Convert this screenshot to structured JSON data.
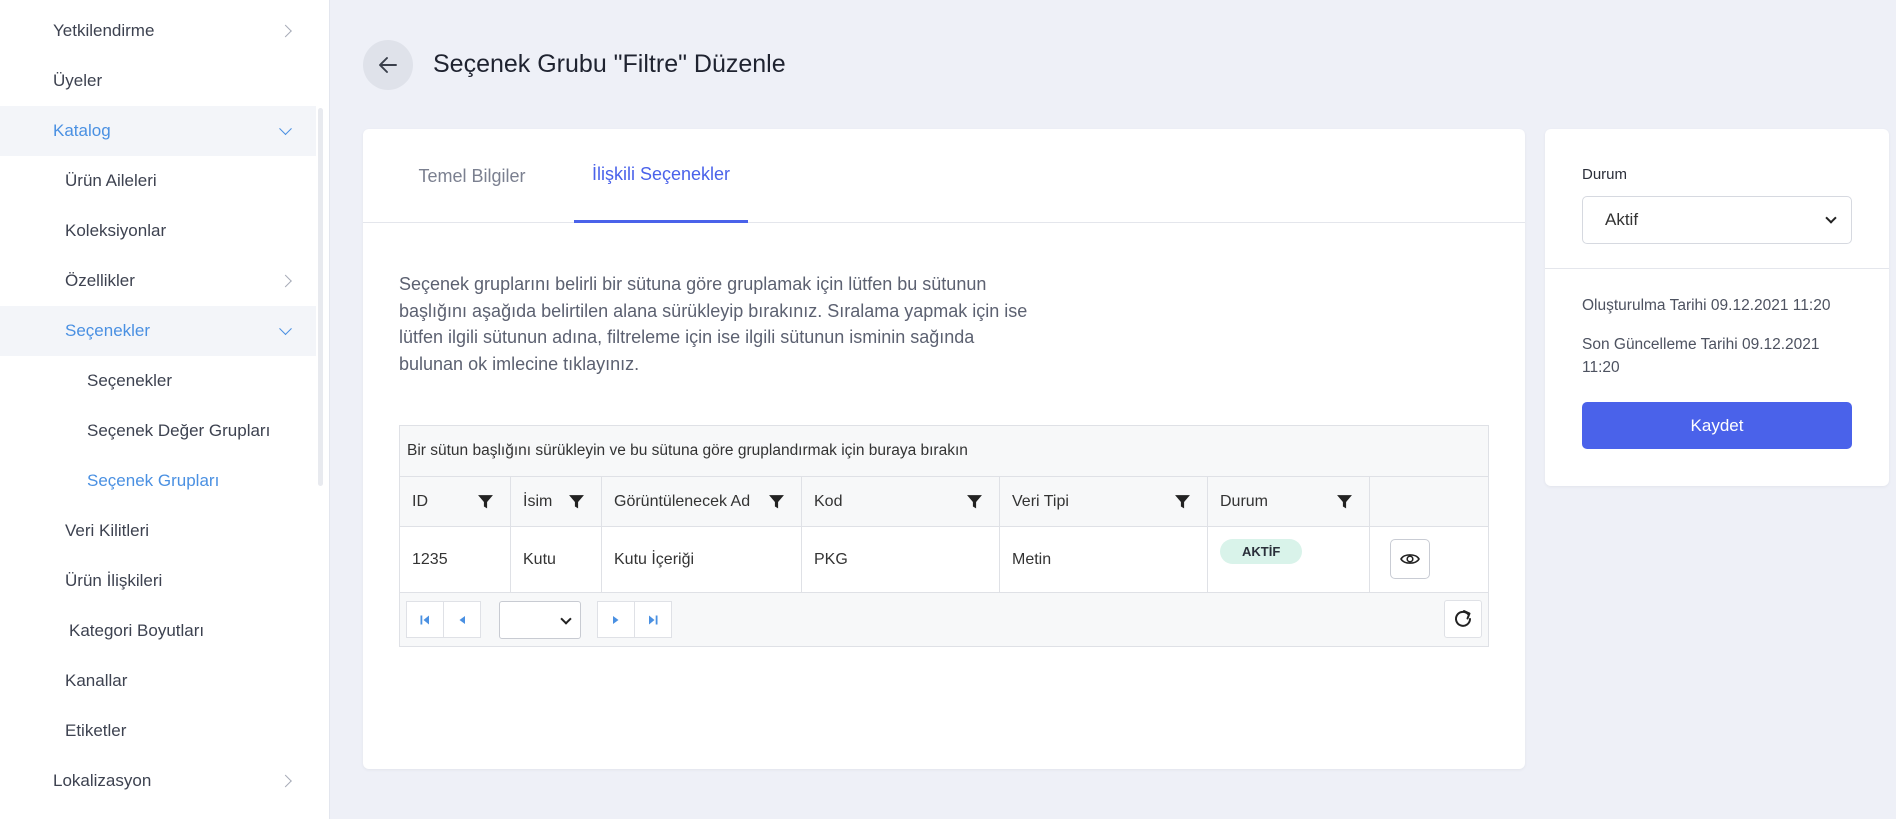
{
  "sidebar": {
    "items": [
      {
        "label": "Yetkilendirme"
      },
      {
        "label": "Üyeler"
      },
      {
        "label": "Katalog"
      },
      {
        "label": "Ürün Aileleri"
      },
      {
        "label": "Koleksiyonlar"
      },
      {
        "label": "Özellikler"
      },
      {
        "label": "Seçenekler"
      },
      {
        "label": "Seçenekler"
      },
      {
        "label": "Seçenek Değer Grupları"
      },
      {
        "label": "Seçenek Grupları"
      },
      {
        "label": "Veri Kilitleri"
      },
      {
        "label": "Ürün İlişkileri"
      },
      {
        "label": "Kategori Boyutları"
      },
      {
        "label": "Kanallar"
      },
      {
        "label": "Etiketler"
      },
      {
        "label": "Lokalizasyon"
      }
    ]
  },
  "header": {
    "title": "Seçenek Grubu \"Filtre\" Düzenle"
  },
  "tabs": [
    {
      "label": "Temel Bilgiler",
      "active": false
    },
    {
      "label": "İlişkili Seçenekler",
      "active": true
    }
  ],
  "description": "Seçenek gruplarını belirli bir sütuna göre gruplamak için lütfen bu sütunun başlığını aşağıda belirtilen alana sürükleyip bırakınız. Sıralama yapmak için ise lütfen ilgili sütunun adına, filtreleme için ise ilgili sütunun isminin sağında bulunan ok imlecine tıklayınız.",
  "grid": {
    "group_panel": "Bir sütun başlığını sürükleyin ve bu sütuna göre gruplandırmak için buraya bırakın",
    "columns": [
      "ID",
      "İsim",
      "Görüntülenecek Ad",
      "Kod",
      "Veri Tipi",
      "Durum"
    ],
    "rows": [
      {
        "id": "1235",
        "name": "Kutu",
        "display_name": "Kutu İçeriği",
        "code": "PKG",
        "data_type": "Metin",
        "status": "AKTİF"
      }
    ]
  },
  "side": {
    "status_label": "Durum",
    "status_value": "Aktif",
    "created": "Oluşturulma Tarihi 09.12.2021 11:20",
    "updated": "Son Güncelleme Tarihi 09.12.2021 11:20",
    "save_label": "Kaydet"
  },
  "colors": {
    "accent": "#4a62ea",
    "sidebar_active": "#4a90e2",
    "badge_bg": "#d9f3ea"
  }
}
